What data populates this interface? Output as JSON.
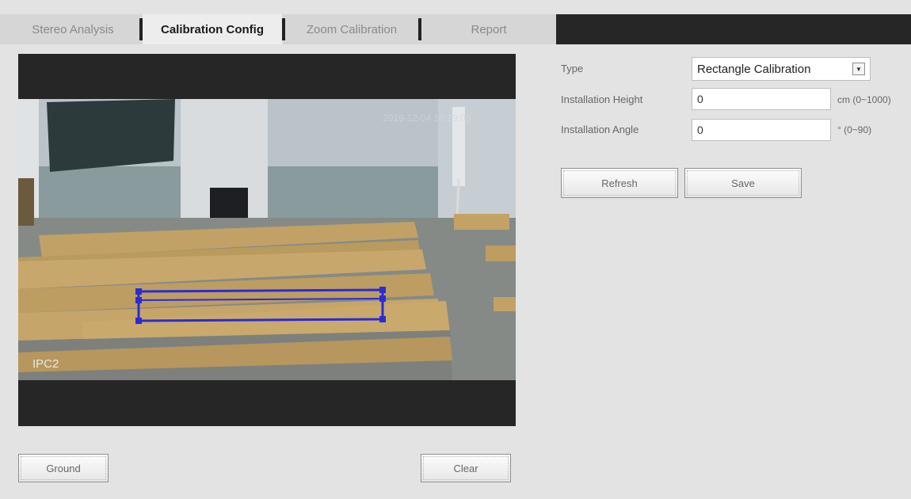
{
  "tabs": [
    {
      "label": "Stereo Analysis",
      "active": false
    },
    {
      "label": "Calibration Config",
      "active": true
    },
    {
      "label": "Zoom Calibration",
      "active": false
    },
    {
      "label": "Report",
      "active": false
    }
  ],
  "video": {
    "channel_label": "IPC2",
    "timestamp": "2019-12-04 10:29:03"
  },
  "video_buttons": {
    "ground": "Ground",
    "clear": "Clear"
  },
  "config": {
    "type_label": "Type",
    "type_value": "Rectangle Calibration",
    "height_label": "Installation Height",
    "height_value": "0",
    "height_unit": "cm (0~1000)",
    "angle_label": "Installation Angle",
    "angle_value": "0",
    "angle_unit": "° (0~90)"
  },
  "actions": {
    "refresh": "Refresh",
    "save": "Save"
  },
  "colors": {
    "calibration_box": "#2a2bd6",
    "tab_bar_dark": "#262626"
  }
}
